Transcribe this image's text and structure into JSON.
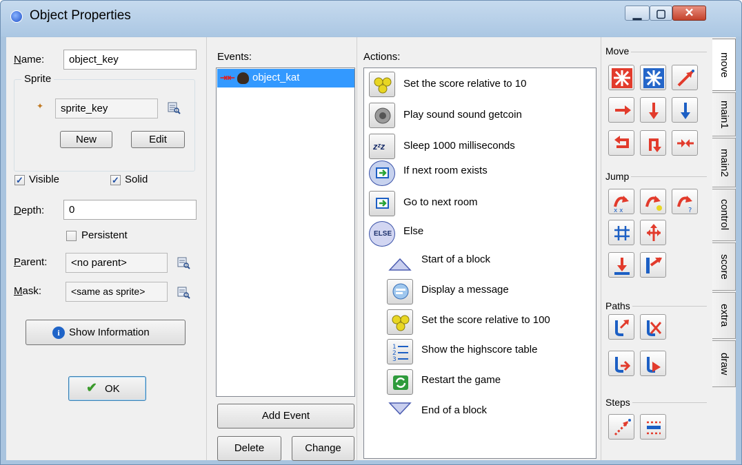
{
  "window": {
    "title": "Object Properties",
    "controls": {
      "minimize": "▁",
      "maximize": "▢",
      "close": "✕"
    }
  },
  "props": {
    "name_label": "Name:",
    "name_value": "object_key",
    "sprite_group": "Sprite",
    "sprite_value": "sprite_key",
    "new_btn": "New",
    "edit_btn": "Edit",
    "visible_label": "Visible",
    "visible_checked": true,
    "solid_label": "Solid",
    "solid_checked": true,
    "depth_label": "Depth:",
    "depth_value": "0",
    "persistent_label": "Persistent",
    "persistent_checked": false,
    "parent_label": "Parent:",
    "parent_value": "<no parent>",
    "mask_label": "Mask:",
    "mask_value": "<same as sprite>",
    "show_info_btn": "Show Information",
    "ok_btn": "OK"
  },
  "events": {
    "label": "Events:",
    "items": [
      "object_kat"
    ],
    "selected_index": 0,
    "add_btn": "Add Event",
    "delete_btn": "Delete",
    "change_btn": "Change"
  },
  "actions": {
    "label": "Actions:",
    "items": [
      {
        "text": "Set the score relative to 10",
        "icon": "score-icon"
      },
      {
        "text": "Play sound sound getcoin",
        "icon": "sound-icon"
      },
      {
        "text": "Sleep 1000 milliseconds",
        "icon": "sleep-icon"
      },
      {
        "text": "If next room exists",
        "icon": "if-next-room-icon"
      },
      {
        "text": "Go to next room",
        "icon": "next-room-icon"
      },
      {
        "text": "Else",
        "icon": "else-icon"
      },
      {
        "text": "Start of a block",
        "icon": "block-start-icon"
      },
      {
        "text": "Display a message",
        "icon": "message-icon"
      },
      {
        "text": "Set the score relative to 100",
        "icon": "score-icon"
      },
      {
        "text": "Show the highscore table",
        "icon": "highscore-icon"
      },
      {
        "text": "Restart the game",
        "icon": "restart-icon"
      },
      {
        "text": "End of a block",
        "icon": "block-end-icon"
      }
    ]
  },
  "library": {
    "groups": {
      "move": "Move",
      "jump": "Jump",
      "paths": "Paths",
      "steps": "Steps"
    },
    "tabs": [
      "move",
      "main1",
      "main2",
      "control",
      "score",
      "extra",
      "draw"
    ],
    "active_tab": "move",
    "icons": {
      "move": [
        "move-fixed-icon",
        "move-free-icon",
        "move-towards-icon",
        "speed-horizontal-icon",
        "speed-vertical-icon",
        "gravity-icon",
        "reverse-horizontal-icon",
        "reverse-vertical-icon",
        "friction-icon"
      ],
      "jump": [
        "jump-to-position-icon",
        "jump-to-start-icon",
        "jump-to-random-icon",
        "align-to-grid-icon",
        "wrap-screen-icon",
        "move-to-contact-icon",
        "bounce-icon"
      ],
      "paths": [
        "set-path-icon",
        "end-path-icon",
        "path-position-icon",
        "path-speed-icon"
      ],
      "steps": [
        "step-towards-icon",
        "step-avoiding-icon"
      ]
    },
    "colors": {
      "red": "#d42020",
      "blue": "#1c5fc4"
    }
  }
}
